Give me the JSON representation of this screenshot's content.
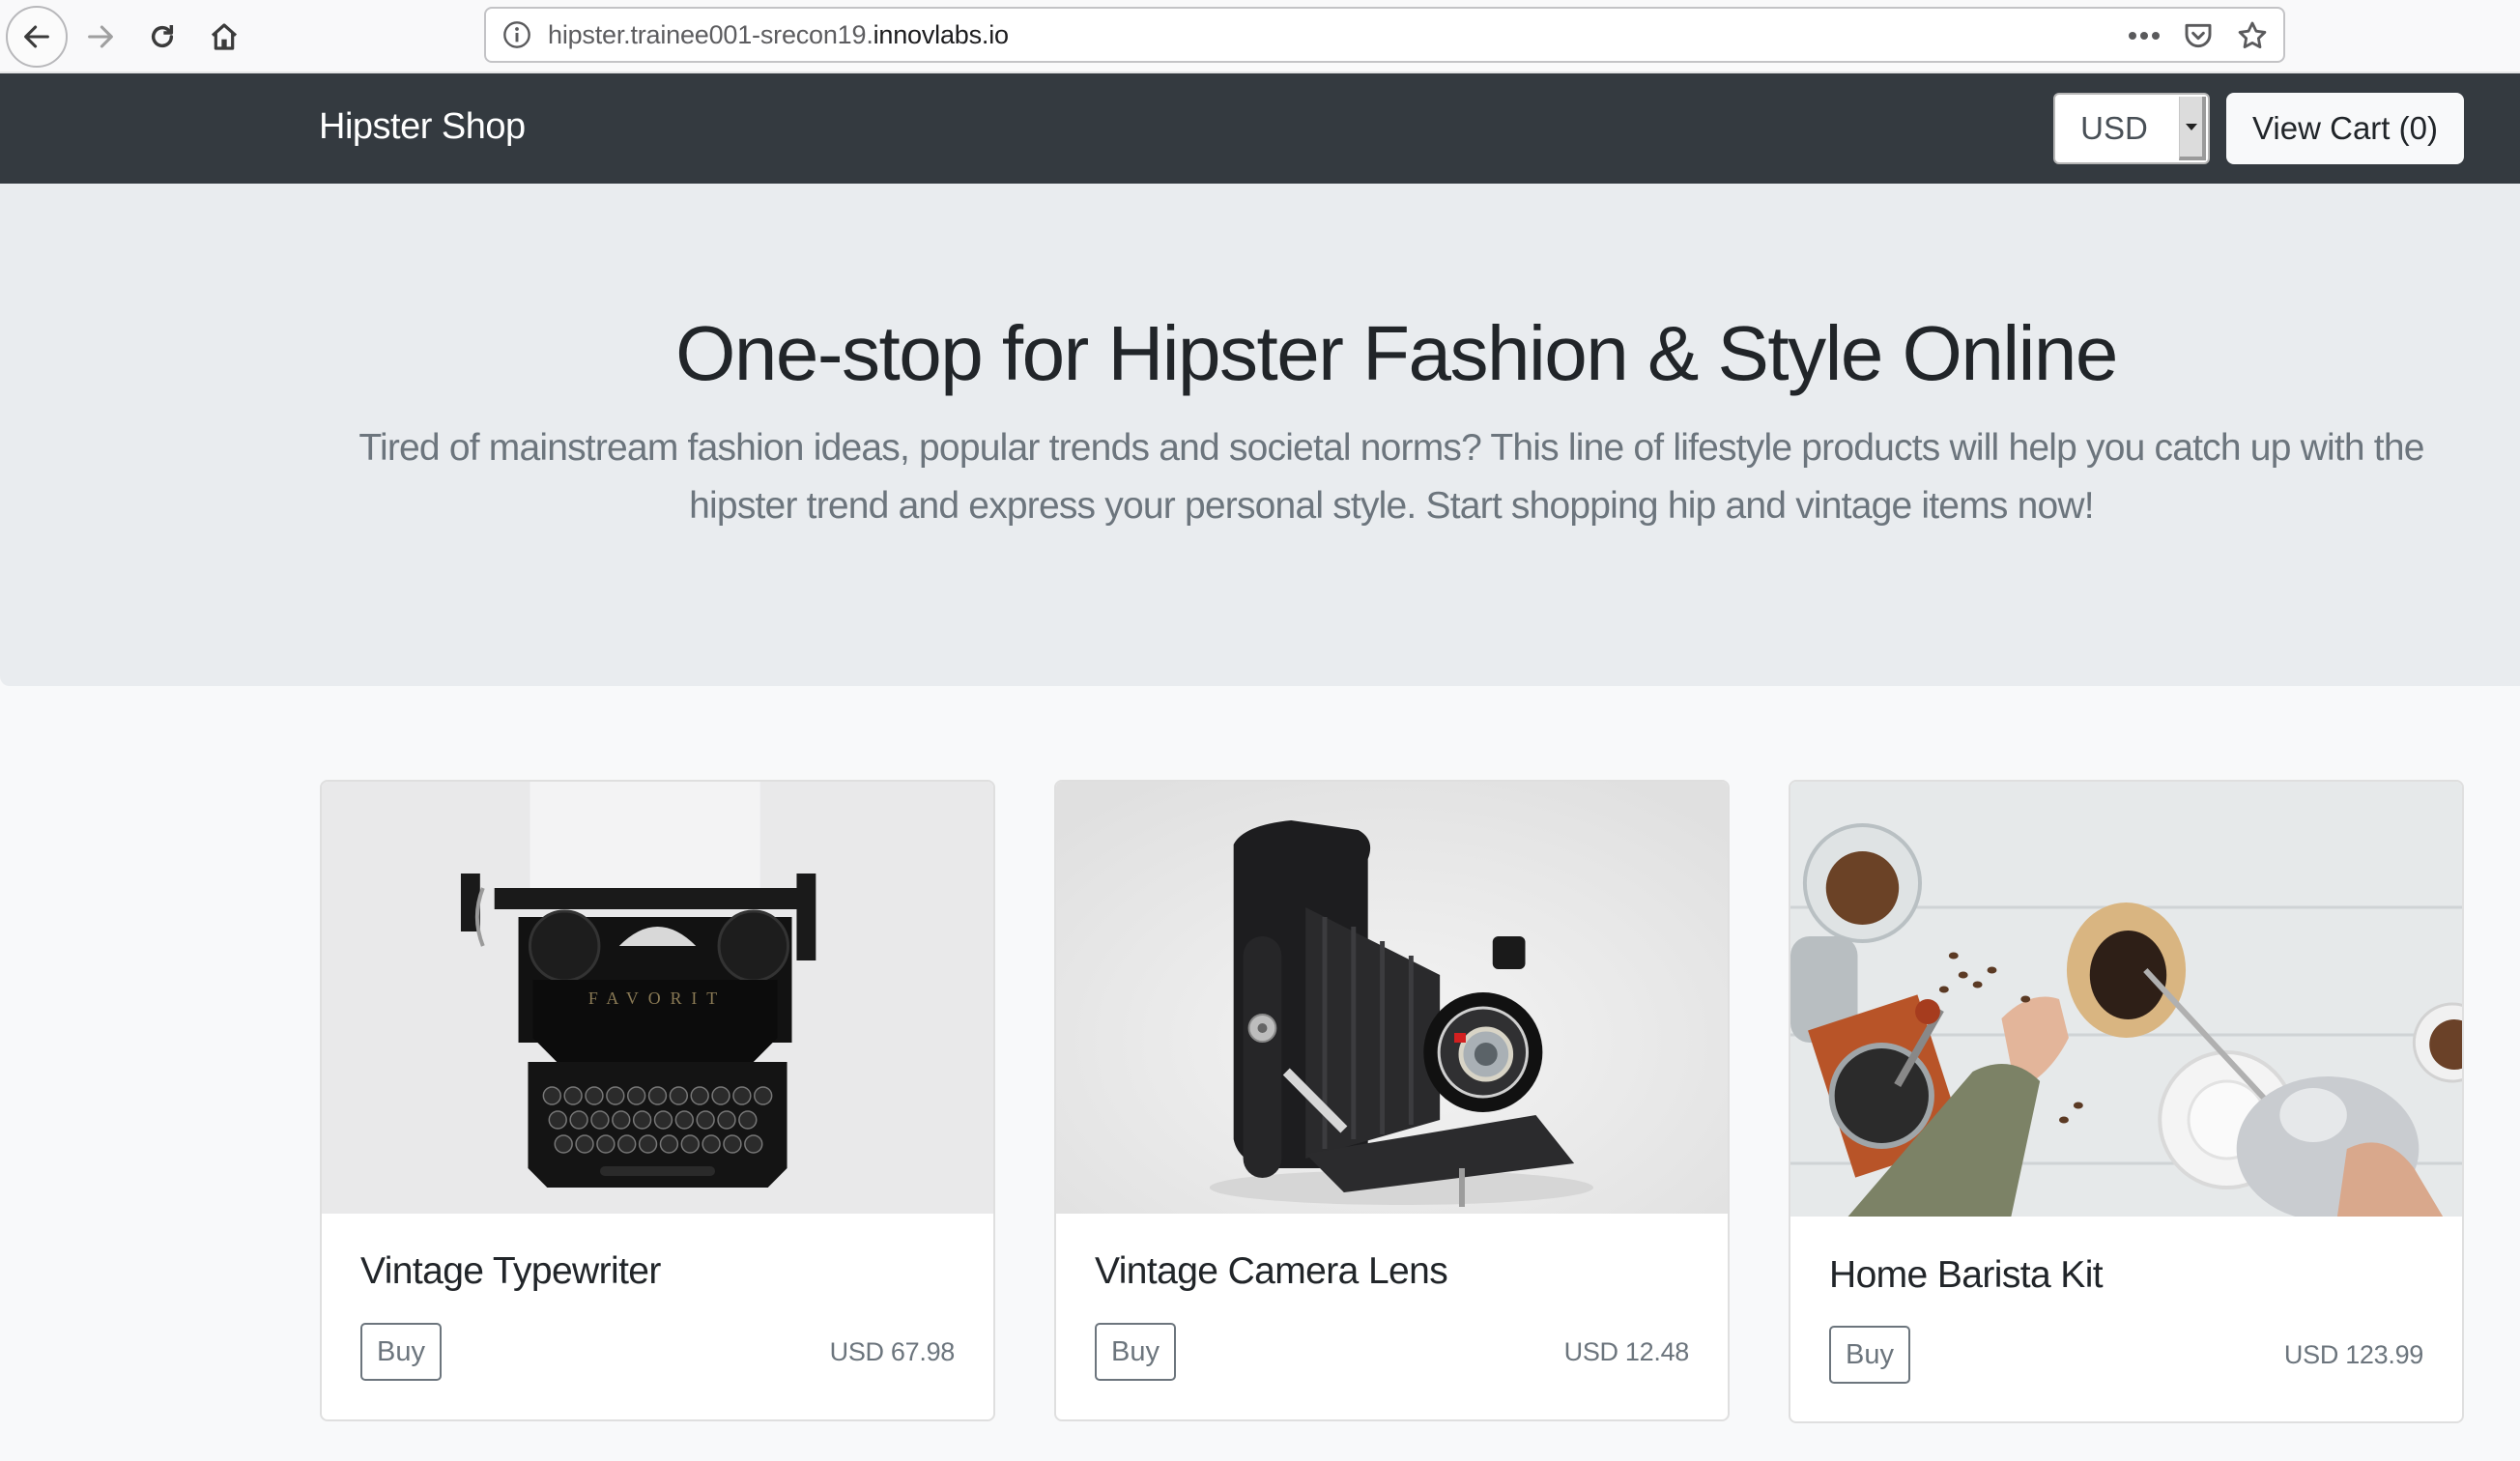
{
  "browser": {
    "url_prefix": "hipster.trainee001-srecon19.",
    "url_domain": "innovlabs.io",
    "icons": [
      "back-arrow-icon",
      "forward-arrow-icon",
      "reload-icon",
      "home-icon",
      "info-icon",
      "more-actions-icon",
      "pocket-icon",
      "bookmark-star-icon"
    ]
  },
  "navbar": {
    "brand": "Hipster Shop",
    "currency": {
      "selected": "USD"
    },
    "cart_label": "View Cart (0)"
  },
  "hero": {
    "title": "One-stop for Hipster Fashion & Style Online",
    "lead": "Tired of mainstream fashion ideas, popular trends and societal norms? This line of lifestyle products will help you catch up with the hipster trend and express your personal style. Start shopping hip and vintage items now!"
  },
  "products": [
    {
      "name": "Vintage Typewriter",
      "buy_label": "Buy",
      "price": "USD 67.98",
      "image": "typewriter-image"
    },
    {
      "name": "Vintage Camera Lens",
      "buy_label": "Buy",
      "price": "USD 12.48",
      "image": "camera-image"
    },
    {
      "name": "Home Barista Kit",
      "buy_label": "Buy",
      "price": "USD 123.99",
      "image": "barista-kit-image"
    }
  ],
  "colors": {
    "navbar_bg": "#343a40",
    "jumbotron_bg": "#e9ecef",
    "page_bg": "#f8f9fa",
    "muted_text": "#6c757d",
    "heading_text": "#212529"
  }
}
